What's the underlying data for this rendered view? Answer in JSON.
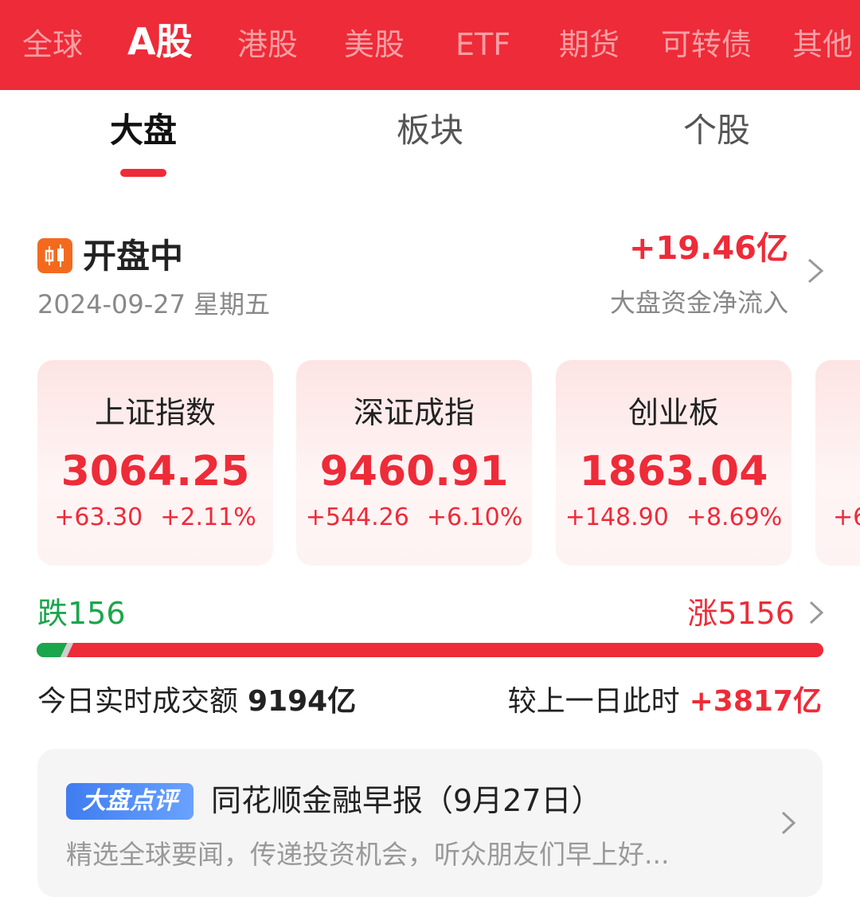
{
  "market_tabs": [
    {
      "label": "全球",
      "active": false
    },
    {
      "label": "A股",
      "active": true
    },
    {
      "label": "港股",
      "active": false
    },
    {
      "label": "美股",
      "active": false
    },
    {
      "label": "ETF",
      "active": false
    },
    {
      "label": "期货",
      "active": false
    },
    {
      "label": "可转债",
      "active": false
    },
    {
      "label": "其他",
      "active": false
    }
  ],
  "sub_tabs": [
    {
      "label": "大盘",
      "active": true
    },
    {
      "label": "板块",
      "active": false
    },
    {
      "label": "个股",
      "active": false
    }
  ],
  "status": {
    "icon": "candlestick-icon",
    "title": "开盘中",
    "date": "2024-09-27 星期五",
    "net_inflow": "+19.46亿",
    "net_inflow_label": "大盘资金净流入"
  },
  "indices": [
    {
      "name": "上证指数",
      "value": "3064.25",
      "change": "+63.30",
      "percent": "+2.11%"
    },
    {
      "name": "深证成指",
      "value": "9460.91",
      "change": "+544.26",
      "percent": "+6.10%"
    },
    {
      "name": "创业板",
      "value": "1863.04",
      "change": "+148.90",
      "percent": "+8.69%"
    },
    {
      "name": "",
      "value": "",
      "change": "+6",
      "percent": ""
    }
  ],
  "breadth": {
    "fall_label": "跌156",
    "rise_label": "涨5156",
    "fall_count": 156,
    "rise_count": 5156
  },
  "turnover": {
    "label": "今日实时成交额",
    "value": "9194亿",
    "compare_label": "较上一日此时",
    "compare_value": "+3817亿"
  },
  "commentary": {
    "badge": "大盘点评",
    "title": "同花顺金融早报（9月27日）",
    "description": "精选全球要闻，传递投资机会，听众朋友们早上好..."
  },
  "colors": {
    "brand_red": "#ee2b38",
    "rise_red": "#ee2b38",
    "fall_green": "#1aa64b",
    "badge_blue": "#3f7cf0"
  }
}
